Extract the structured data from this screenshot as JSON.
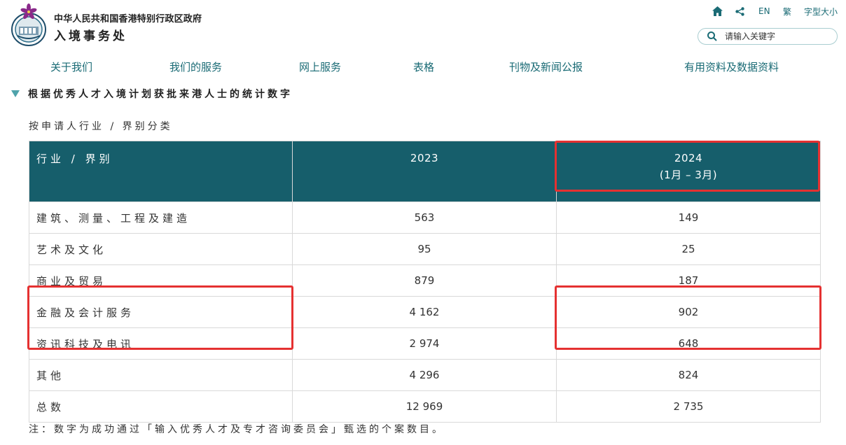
{
  "header": {
    "gov_name": "中华人民共和国香港特别行政区政府",
    "dept_name": "入境事务处",
    "logo_icon": "hk-immigration-emblem-icon"
  },
  "utility": {
    "home_icon": "home-icon",
    "share_icon": "share-icon",
    "lang_en": "EN",
    "lang_trad": "繁",
    "font_size": "字型大小"
  },
  "search": {
    "placeholder": "请输入关键字"
  },
  "nav": [
    "关于我们",
    "我们的服务",
    "网上服务",
    "表格",
    "刊物及新闻公报",
    "有用资料及数据资料"
  ],
  "section": {
    "title": "根据优秀人才入境计划获批来港人士的统计数字",
    "subtitle": "按申请人行业 / 界别分类"
  },
  "table": {
    "headers": {
      "category": "行业 / 界别",
      "col1": "2023",
      "col2_line1": "2024",
      "col2_line2": "(1月 – 3月)"
    },
    "rows": [
      {
        "category": "建筑、测量、工程及建造",
        "y2023": "563",
        "y2024": "149"
      },
      {
        "category": "艺术及文化",
        "y2023": "95",
        "y2024": "25"
      },
      {
        "category": "商业及贸易",
        "y2023": "879",
        "y2024": "187"
      },
      {
        "category": "金融及会计服务",
        "y2023": "4 162",
        "y2024": "902"
      },
      {
        "category": "资讯科技及电讯",
        "y2023": "2 974",
        "y2024": "648"
      },
      {
        "category": "其他",
        "y2023": "4 296",
        "y2024": "824"
      },
      {
        "category": "总数",
        "y2023": "12 969",
        "y2024": "2 735"
      }
    ]
  },
  "note": "注：数字为成功通过「输入优秀人才及专才咨询委员会」甄选的个案数目。",
  "colors": {
    "header_bg": "#165e6b",
    "link": "#1a6b75",
    "highlight": "#e53131"
  }
}
